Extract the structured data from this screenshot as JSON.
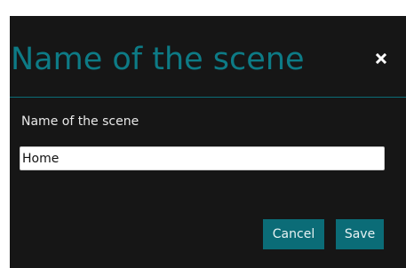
{
  "dialog": {
    "title": "Name of the scene",
    "close_icon": "close-icon",
    "field_label": "Name of the scene",
    "name_value": "Home",
    "cancel_label": "Cancel",
    "save_label": "Save"
  },
  "colors": {
    "background": "#161616",
    "accent": "#0b6c77",
    "title": "#0d7b86",
    "label_text": "#e9e9e9",
    "input_background": "#ffffff"
  }
}
